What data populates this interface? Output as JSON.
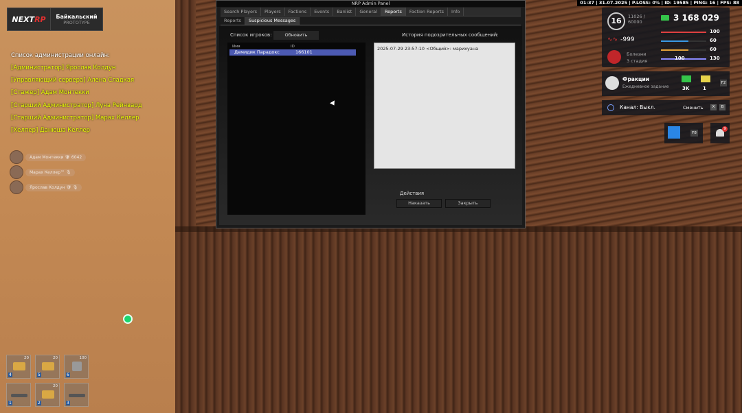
{
  "status_bar": "01:37 | 31.07.2025 | P.LOSS: 0% | ID: 19585 | PING: 16 | FPS: 88",
  "logo": {
    "brand_a": "NEXT",
    "brand_b": "RP",
    "server": "Байкальский",
    "subtitle": "PROTOTYPE"
  },
  "admins": {
    "header": "Список администрации онлайн:",
    "rows": [
      "[Администратор] Ярослав Колдун",
      "[Управляющий сервера] Алена Сладкая",
      "[Стажер] Адам Монтекки",
      "[Старший Администратор] Луна Рейнвард",
      "[Старший Администратор] Марах Келлер",
      "[Хелпер] Данюша Келлер"
    ]
  },
  "voice": [
    {
      "name": "Адам Монтекки",
      "extra": "🛡 6042"
    },
    {
      "name": "Марах Келлер™",
      "extra": "🎙"
    },
    {
      "name": "Ярослав Колдун",
      "extra": "🛡 🎙"
    }
  ],
  "inventory": [
    {
      "n": "4",
      "c": "20",
      "icon": "box"
    },
    {
      "n": "5",
      "c": "20",
      "icon": "box"
    },
    {
      "n": "6",
      "c": "100",
      "icon": "nut"
    },
    {
      "n": "1",
      "c": "",
      "icon": "gun"
    },
    {
      "n": "2",
      "c": "20",
      "icon": "box"
    },
    {
      "n": "3",
      "c": "",
      "icon": "gun"
    }
  ],
  "panel": {
    "title": "NRP Admin Panel",
    "tabs": [
      "Search Players",
      "Players",
      "Factions",
      "Events",
      "Banlist",
      "General",
      "Reports",
      "Faction Reports",
      "Info"
    ],
    "active_tab": "Reports",
    "subtabs": [
      "Reports",
      "Suspicious Messages"
    ],
    "active_subtab": "Suspicious Messages",
    "players_label": "Список игроков:",
    "refresh": "Обновить",
    "col_name": "Имя",
    "col_id": "ID",
    "selected_player": {
      "name": "Демидик Парадокс",
      "id": "166101"
    },
    "history_label": "История подозрительных сообщений:",
    "history_message": "2025-07-29 23:57:10 <Общий>: марихуана",
    "actions_label": "Действия",
    "punish": "Наказать",
    "close": "Закрыть"
  },
  "hud": {
    "level": "16",
    "xp": "11026 /",
    "xp_max": "60000",
    "money": "3 168 029",
    "karma": "-999",
    "disease_title": "Болезни",
    "disease_stage": "3 стадия",
    "stats": [
      {
        "value": "100",
        "color": "#e04040",
        "fill": 1.0
      },
      {
        "value": "60",
        "color": "#3a9ae6",
        "fill": 0.6
      },
      {
        "value": "60",
        "color": "#e6a53a",
        "fill": 0.6
      },
      {
        "value": "130",
        "color": "#8a8aff",
        "fill": 1.0
      }
    ],
    "stat_extra": "100",
    "factions_title": "Фракции",
    "factions_sub": "Ежедневное задание",
    "factions_a": "3K",
    "factions_b": "1",
    "factions_key": "F2",
    "channel_label": "Канал:",
    "channel_value": "Выкл.",
    "change_label": "Сменить",
    "key_x": "X",
    "key_b": "B",
    "calendar_key": "F8",
    "notifications": "9"
  }
}
